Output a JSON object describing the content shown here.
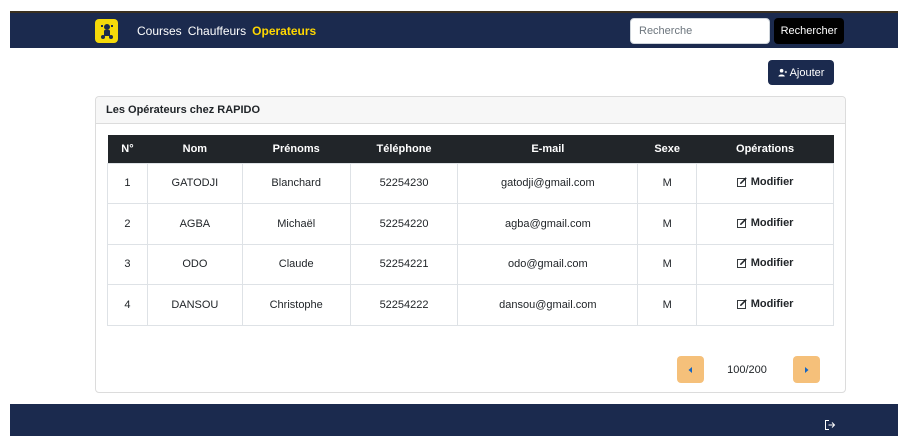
{
  "nav": {
    "logo": "scooter-logo-icon",
    "links": [
      "Courses",
      "Chauffeurs",
      "Operateurs"
    ],
    "active": "Operateurs",
    "search_placeholder": "Recherche",
    "search_button": "Rechercher"
  },
  "add_button": {
    "label": "Ajouter",
    "icon": "add-user-icon"
  },
  "card": {
    "title": "Les Opérateurs chez RAPIDO"
  },
  "table": {
    "headers": [
      "N°",
      "Nom",
      "Prénoms",
      "Téléphone",
      "E-mail",
      "Sexe",
      "Opérations"
    ],
    "rows": [
      {
        "num": "1",
        "nom": "GATODJI",
        "prenoms": "Blanchard",
        "tel": "52254230",
        "email": "gatodji@gmail.com",
        "sexe": "M",
        "op": "Modifier"
      },
      {
        "num": "2",
        "nom": "AGBA",
        "prenoms": "Michaël",
        "tel": "52254220",
        "email": "agba@gmail.com",
        "sexe": "M",
        "op": "Modifier"
      },
      {
        "num": "3",
        "nom": "ODO",
        "prenoms": "Claude",
        "tel": "52254221",
        "email": "odo@gmail.com",
        "sexe": "M",
        "op": "Modifier"
      },
      {
        "num": "4",
        "nom": "DANSOU",
        "prenoms": "Christophe",
        "tel": "52254222",
        "email": "dansou@gmail.com",
        "sexe": "M",
        "op": "Modifier"
      }
    ]
  },
  "pagination": {
    "label": "100/200"
  },
  "colors": {
    "navy": "#1b2a4e",
    "accent": "#ffd700",
    "pager": "#f5c07a"
  },
  "footer": {
    "logout_icon": "logout-icon"
  }
}
